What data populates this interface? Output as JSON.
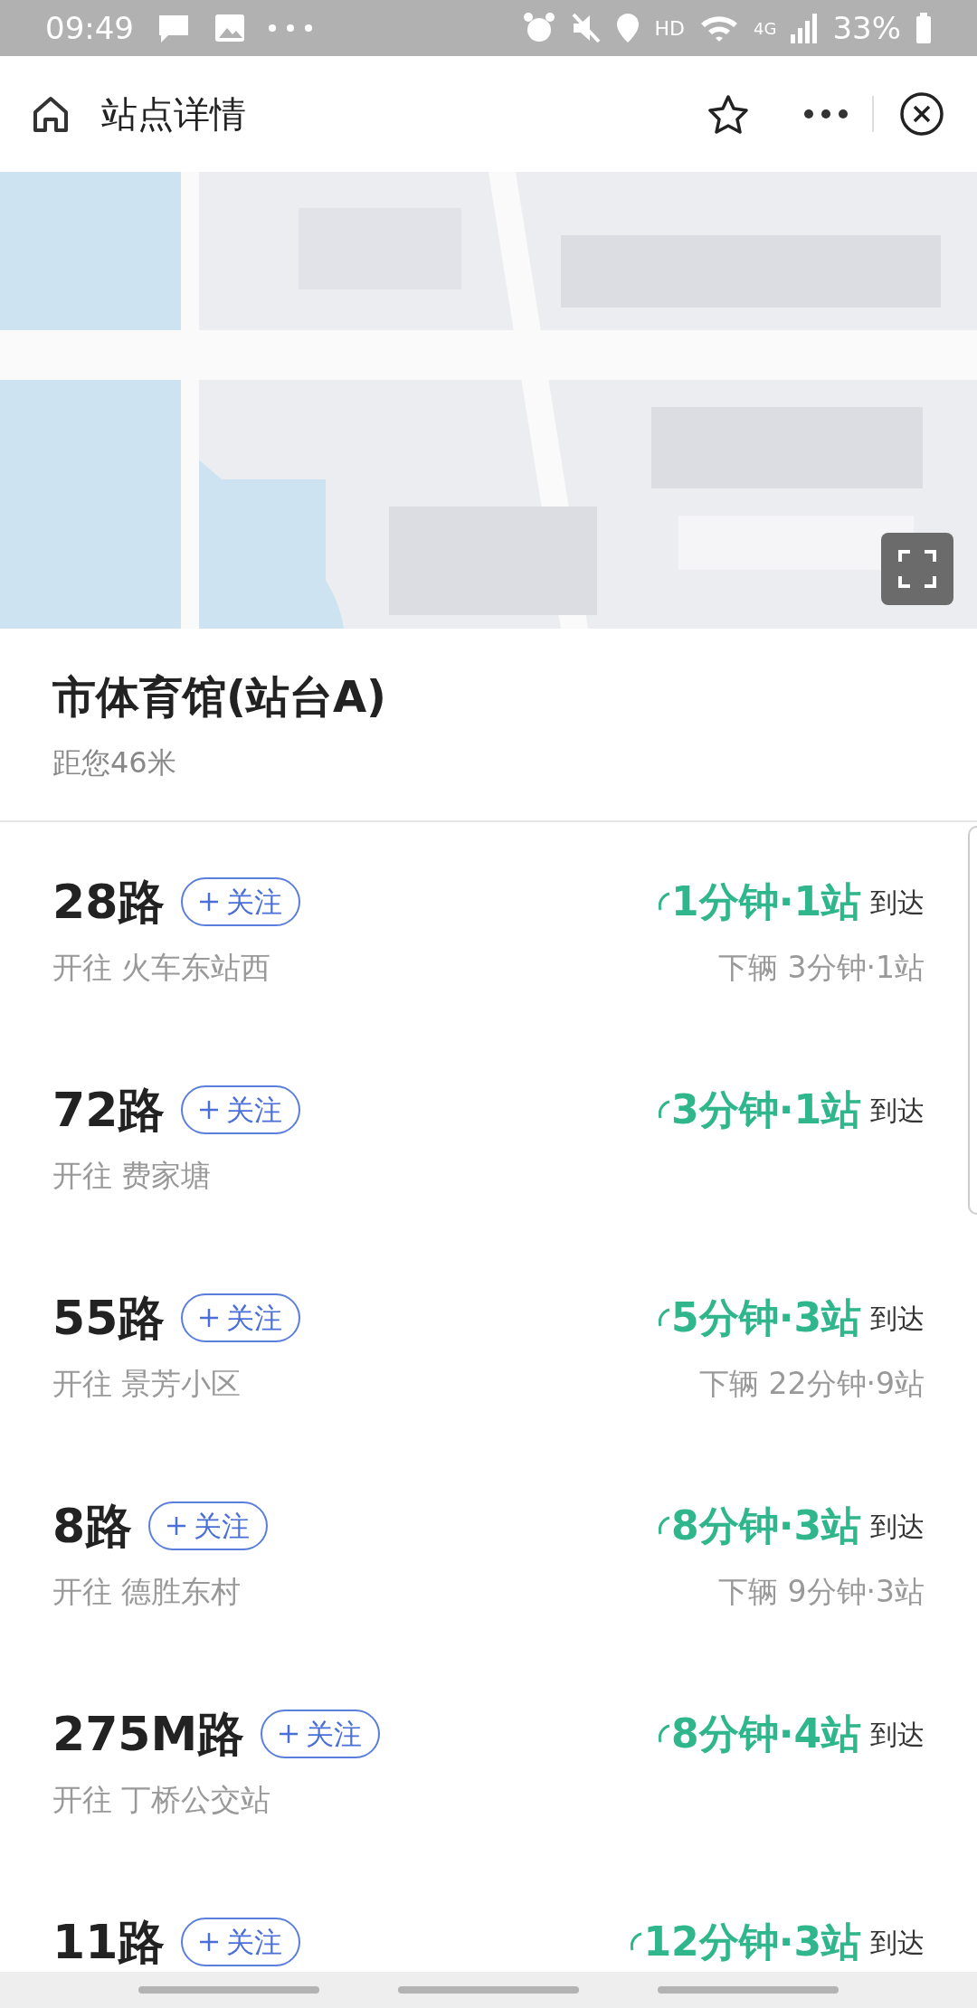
{
  "status_bar": {
    "time": "09:49",
    "hd": "HD",
    "network": "4G",
    "battery": "33%"
  },
  "header": {
    "title": "站点详情"
  },
  "station": {
    "name": "市体育馆(站台A)",
    "distance": "距您46米"
  },
  "routes": [
    {
      "name": "28路",
      "follow": "关注",
      "destination": "开往 火车东站西",
      "arrival": "1分钟·1站",
      "arrive_label": "到达",
      "next": "下辆 3分钟·1站"
    },
    {
      "name": "72路",
      "follow": "关注",
      "destination": "开往 费家塘",
      "arrival": "3分钟·1站",
      "arrive_label": "到达"
    },
    {
      "name": "55路",
      "follow": "关注",
      "destination": "开往 景芳小区",
      "arrival": "5分钟·3站",
      "arrive_label": "到达",
      "next": "下辆 22分钟·9站"
    },
    {
      "name": "8路",
      "follow": "关注",
      "destination": "开往 德胜东村",
      "arrival": "8分钟·3站",
      "arrive_label": "到达",
      "next": "下辆 9分钟·3站"
    },
    {
      "name": "275M路",
      "follow": "关注",
      "destination": "开往 丁桥公交站",
      "arrival": "8分钟·4站",
      "arrive_label": "到达"
    },
    {
      "name": "11路",
      "follow": "关注",
      "arrival": "12分钟·3站",
      "arrive_label": "到达"
    }
  ]
}
